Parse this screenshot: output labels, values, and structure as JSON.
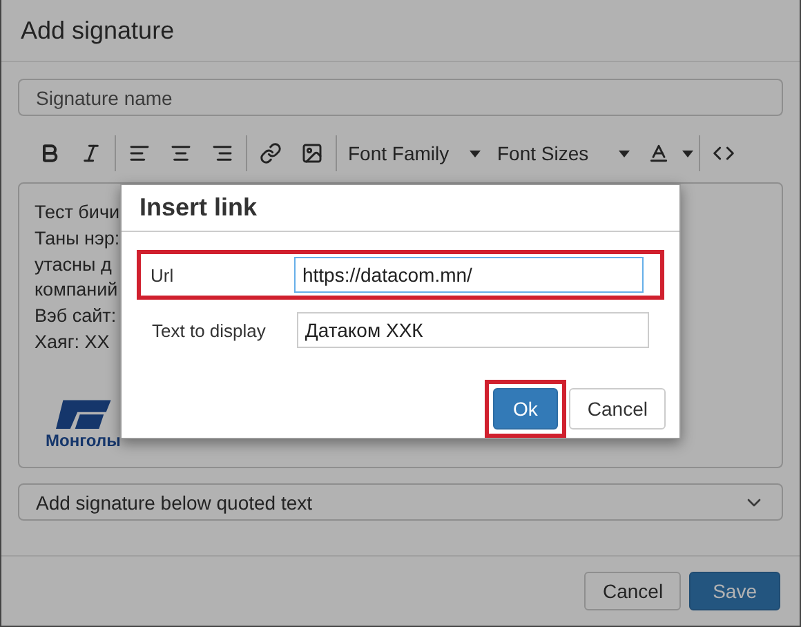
{
  "window": {
    "title": "Add signature"
  },
  "signature_name": {
    "placeholder": "Signature name"
  },
  "toolbar": {
    "font_family": "Font Family",
    "font_sizes": "Font Sizes"
  },
  "editor": {
    "lines": [
      "Тест бичи",
      "Таны нэр:",
      "утасны д",
      "компаний",
      "Вэб сайт:",
      "Хаяг: XX"
    ],
    "logo_caption": "Монголы"
  },
  "placement": {
    "value": "Add signature below quoted text"
  },
  "buttons": [
    {
      "label": "Cancel",
      "kind": "secondary"
    },
    {
      "label": "Save",
      "kind": "primary"
    }
  ],
  "link_dialog": {
    "title": "Insert link",
    "fields": [
      {
        "label": "Url",
        "value": "https://datacom.mn/",
        "highlighted": true,
        "focused": true
      },
      {
        "label": "Text to display",
        "value": "Датаком ХХК",
        "highlighted": false,
        "focused": false
      }
    ],
    "buttons": [
      {
        "label": "Ok",
        "kind": "primary",
        "highlighted": true
      },
      {
        "label": "Cancel",
        "kind": "secondary",
        "highlighted": false
      }
    ]
  }
}
